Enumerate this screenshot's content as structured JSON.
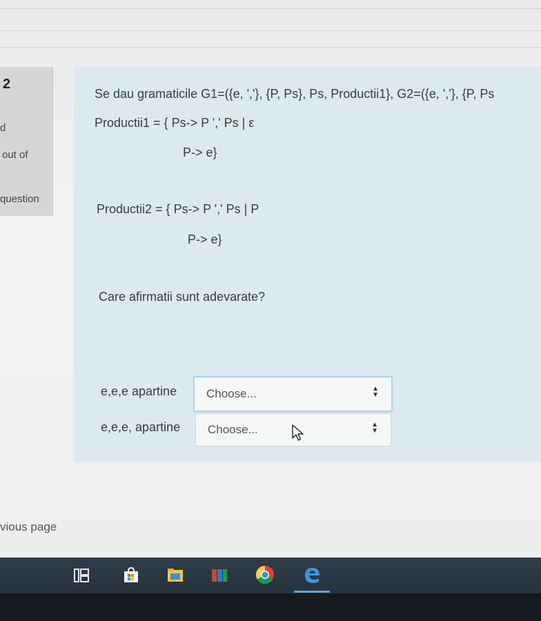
{
  "question_info": {
    "number": "2",
    "state": "d",
    "mark": "out of",
    "flag": "question"
  },
  "question": {
    "intro": "Se dau gramaticile G1=({e, ','}, {P, Ps}, Ps, Productii1}, G2=({e, ','}, {P, Ps",
    "prod1_line1": "Productii1  = { Ps-> P ','  Ps | ε",
    "prod1_line2": "P-> e}",
    "prod2_line1": "Productii2  = { Ps-> P ','  Ps | P",
    "prod2_line2": "P-> e}",
    "prompt": "Care afirmatii sunt adevarate?"
  },
  "answers": [
    {
      "label": "e,e,e apartine",
      "selected": "Choose..."
    },
    {
      "label": "e,e,e, apartine",
      "selected": "Choose..."
    }
  ],
  "nav": {
    "previous_page": "vious page"
  },
  "taskbar": {
    "icons": [
      "task-view-icon",
      "store-icon",
      "file-explorer-icon",
      "office-icon",
      "chrome-icon",
      "edge-icon"
    ]
  }
}
